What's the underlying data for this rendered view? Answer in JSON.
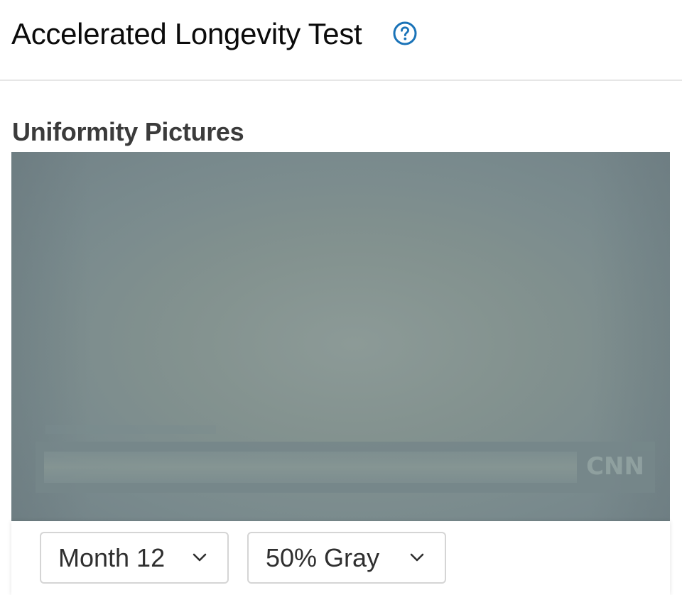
{
  "header": {
    "title": "Accelerated Longevity Test",
    "help_icon": "question-circle-icon",
    "accent_color": "#1a73b8"
  },
  "section": {
    "title": "Uniformity Pictures"
  },
  "picture": {
    "logo_text": "CNN"
  },
  "controls": {
    "month_select": {
      "selected": "Month 12",
      "icon": "chevron-down-icon"
    },
    "pattern_select": {
      "selected": "50% Gray",
      "icon": "chevron-down-icon"
    }
  }
}
